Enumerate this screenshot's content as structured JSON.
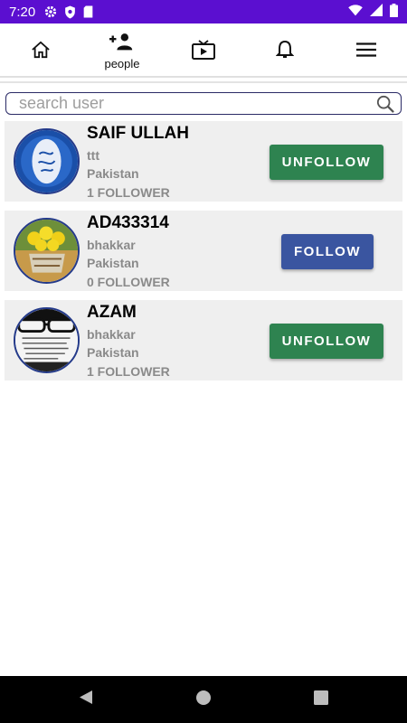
{
  "status_bar": {
    "time": "7:20",
    "bg_color": "#5b0fd0"
  },
  "nav": {
    "items": [
      {
        "icon": "home-icon",
        "label": ""
      },
      {
        "icon": "add-person-icon",
        "label": "people"
      },
      {
        "icon": "tv-icon",
        "label": ""
      },
      {
        "icon": "bell-icon",
        "label": ""
      },
      {
        "icon": "menu-icon",
        "label": ""
      }
    ]
  },
  "search": {
    "placeholder": "search user",
    "value": ""
  },
  "users": [
    {
      "name": "SAIF ULLAH",
      "city": "ttt",
      "country": "Pakistan",
      "followers": "1 FOLLOWER",
      "button": "UNFOLLOW"
    },
    {
      "name": "AD433314",
      "city": "bhakkar",
      "country": "Pakistan",
      "followers": "0 FOLLOWER",
      "button": "FOLLOW"
    },
    {
      "name": "AZAM",
      "city": "bhakkar",
      "country": "Pakistan",
      "followers": "1 FOLLOWER",
      "button": "UNFOLLOW"
    }
  ],
  "colors": {
    "unfollow": "#2e8350",
    "follow": "#3a55a0",
    "card_bg": "#efefef"
  }
}
